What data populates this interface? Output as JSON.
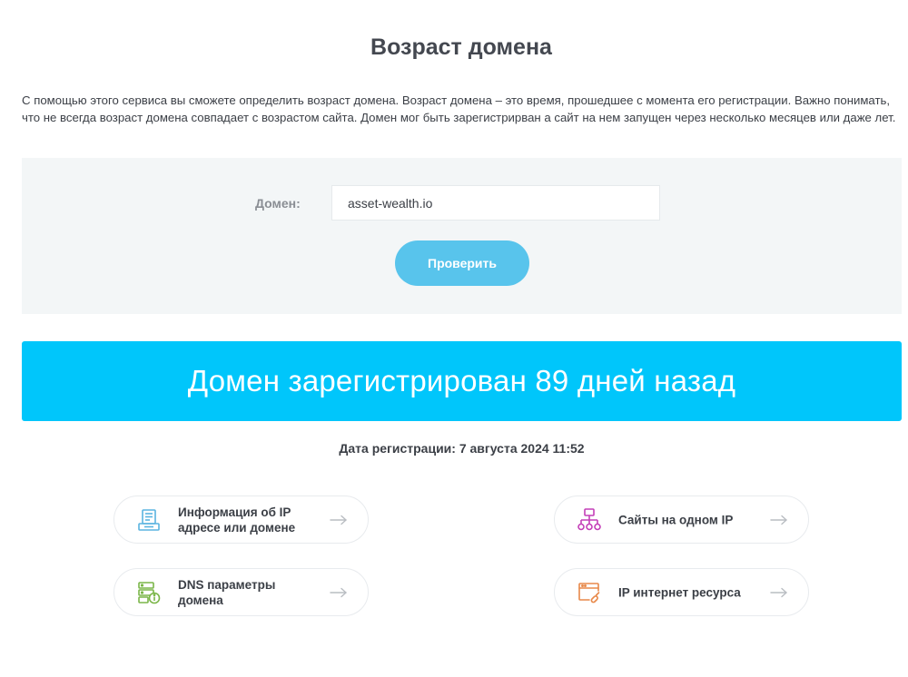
{
  "page": {
    "title": "Возраст домена",
    "description": "С помощью этого сервиса вы сможете определить возраст домена. Возраст домена – это время, прошедшее с момента его регистрации. Важно понимать, что не всегда возраст домена совпадает с возрастом сайта. Домен мог быть зарегистрирван а сайт на нем запущен через несколько месяцев или даже лет."
  },
  "form": {
    "domain_label": "Домен:",
    "domain_value": "asset-wealth.io",
    "submit_label": "Проверить"
  },
  "result": {
    "banner_text": "Домен зарегистрирован 89 дней назад",
    "registration_date": "Дата регистрации: 7 августа 2024 11:52"
  },
  "tools": [
    {
      "label": "Информация об IP адресе или домене",
      "icon": "server-info-icon",
      "color": "#5ab4e0"
    },
    {
      "label": "Сайты на одном IP",
      "icon": "network-tree-icon",
      "color": "#c43fb8"
    },
    {
      "label": "DNS параметры домена",
      "icon": "dns-settings-icon",
      "color": "#7ab648"
    },
    {
      "label": "IP интернет ресурса",
      "icon": "browser-link-icon",
      "color": "#e8894a"
    }
  ],
  "colors": {
    "accent_button": "#58c4ec",
    "banner": "#00c6fb",
    "panel_background": "#f3f6f7"
  }
}
